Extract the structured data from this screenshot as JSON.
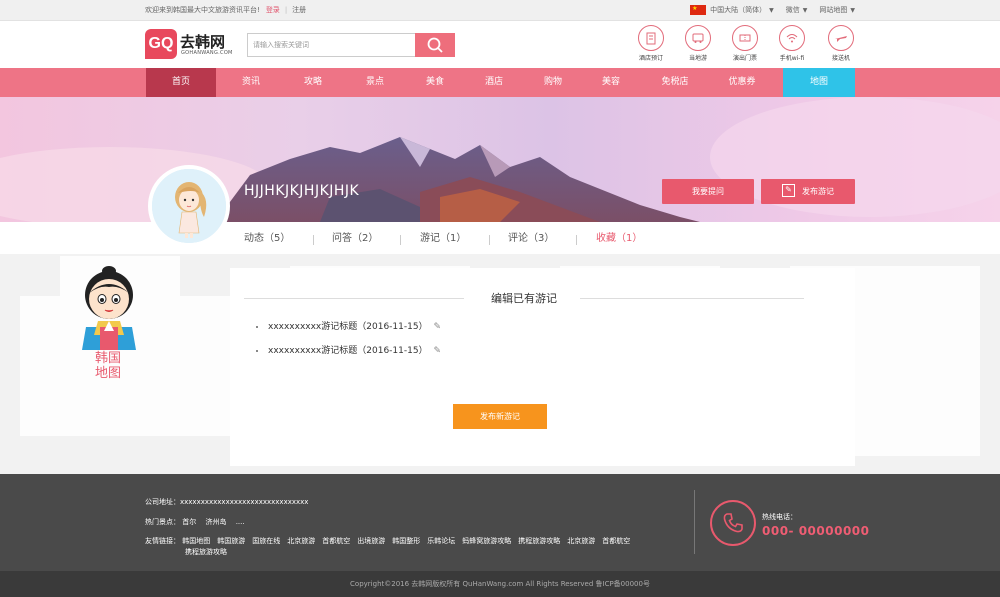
{
  "topbar": {
    "welcome": "欢迎来到韩国最大中文旅游资讯平台!",
    "login": "登录",
    "register": "注册",
    "region": "中国大陆（简体）",
    "wechat": "微信",
    "sitemap": "网站地图"
  },
  "header": {
    "logo_mark": "GQ",
    "logo_text": "去韩网",
    "logo_sub": "GOHANWANG.COM",
    "search_placeholder": "请输入搜索关键词",
    "quick_links": [
      "酒店预订",
      "当地游",
      "演出门票",
      "手机wi-fi",
      "接送机"
    ]
  },
  "nav": {
    "items": [
      "首页",
      "资讯",
      "攻略",
      "景点",
      "美食",
      "酒店",
      "购物",
      "美容",
      "免税店",
      "优惠券",
      "地图"
    ],
    "active_index": 0
  },
  "profile": {
    "username": "HJJHKJKJHJKJHJK",
    "ask_button": "我要提问",
    "publish_button": "发布游记",
    "tabs": [
      {
        "label": "动态（5）"
      },
      {
        "label": "问答（2）"
      },
      {
        "label": "游记（1）"
      },
      {
        "label": "评论（3）"
      },
      {
        "label": "收藏（1）"
      }
    ]
  },
  "sidebar": {
    "korea_map_label_1": "韩国",
    "korea_map_label_2": "地图"
  },
  "content": {
    "heading": "编辑已有游记",
    "items": [
      "xxxxxxxxxx游记标题（2016-11-15）",
      "xxxxxxxxxx游记标题（2016-11-15）"
    ],
    "publish_new": "发布新游记"
  },
  "footer": {
    "address_label": "公司地址：",
    "address": "xxxxxxxxxxxxxxxxxxxxxxxxxxxxxxx",
    "hot_label": "热门景点：",
    "hot_spots": [
      "首尔",
      "济州岛",
      "...."
    ],
    "friend_label": "友情链接：",
    "friend_links": [
      "韩国地图",
      "韩国旅游",
      "国旅在线",
      "北京旅游",
      "首都航空",
      "出境旅游",
      "韩国整形",
      "乐韩论坛",
      "蚂蜂窝旅游攻略",
      "携程旅游攻略",
      "北京旅游",
      "首都航空"
    ],
    "friend_links_2": [
      "携程旅游攻略"
    ],
    "hotline_label": "热线电话：",
    "hotline": "000- 00000000",
    "copyright": "Copyright©2016 去韩网版权所有 QuHanWang.com All Rights Reserved 鲁ICP备00000号"
  },
  "colors": {
    "brand_pink": "#ee7486",
    "active_nav": "#b8384d",
    "map_nav": "#2fc3e8",
    "button_red": "#e8596d",
    "publish_orange": "#f7941d"
  }
}
